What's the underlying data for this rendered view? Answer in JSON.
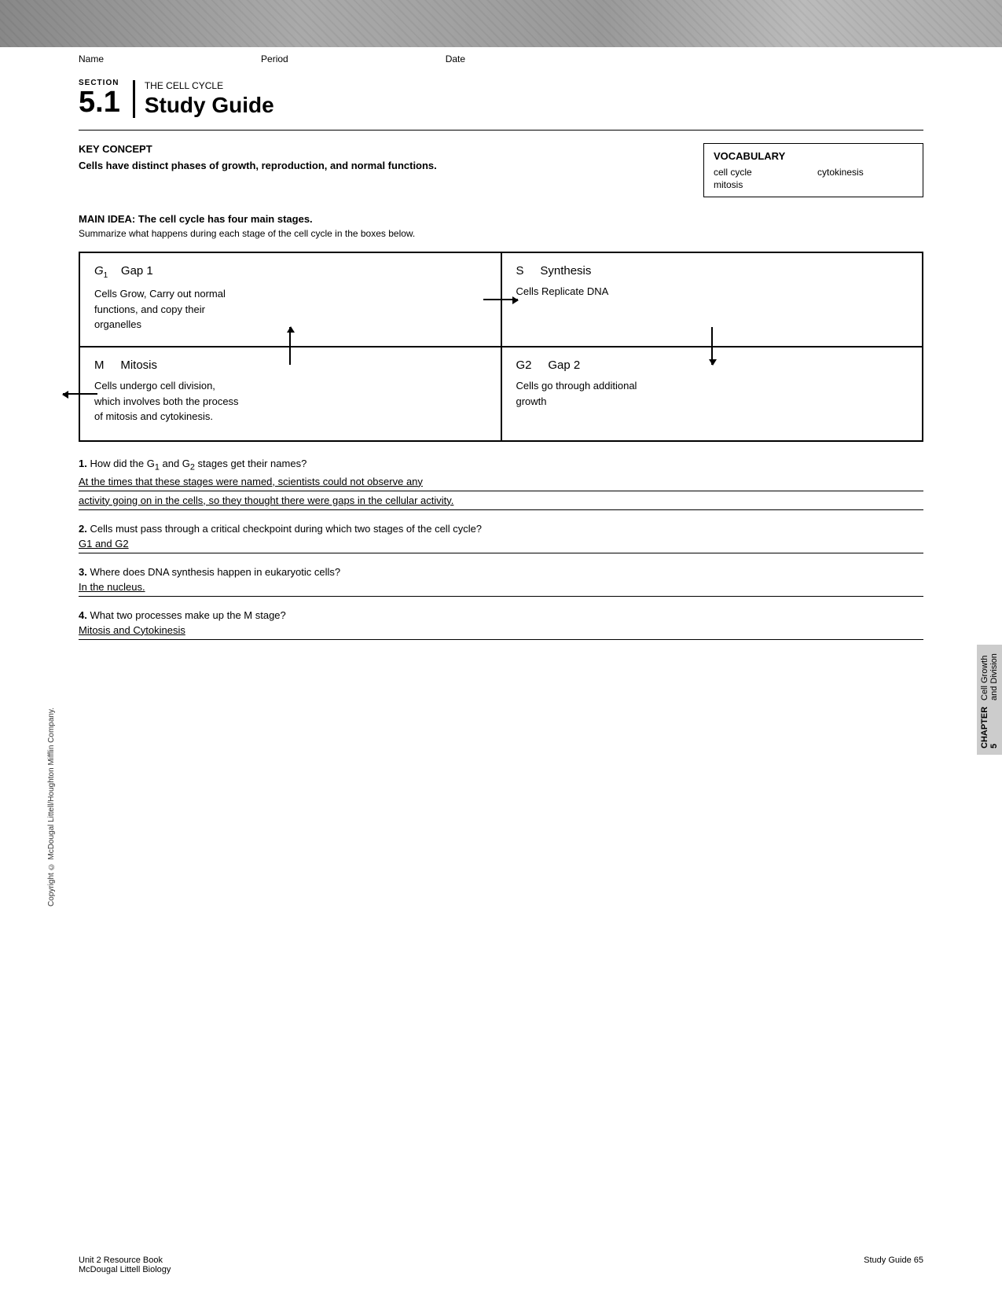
{
  "header": {
    "alt": "Cell biology header image"
  },
  "fields": {
    "name_label": "Name",
    "period_label": "Period",
    "date_label": "Date"
  },
  "section": {
    "label": "SECTION",
    "number": "5.1",
    "subtitle": "THE CELL CYCLE",
    "title": "Study Guide"
  },
  "key_concept": {
    "title": "KEY CONCEPT",
    "text": "Cells have distinct phases of growth, reproduction, and normal functions."
  },
  "vocabulary": {
    "title": "VOCABULARY",
    "terms": [
      "cell cycle",
      "cytokinesis",
      "mitosis",
      ""
    ]
  },
  "main_idea": {
    "label": "MAIN IDEA:",
    "title": "The cell cycle has four main stages.",
    "subtitle": "Summarize what happens during each stage of the cell cycle in the boxes below."
  },
  "diagram": {
    "cells": [
      {
        "id": "g1",
        "letter": "G",
        "subscript": "1",
        "name": "Gap 1",
        "text": "Cells Grow, Carry out normal functions, and copy their organelles"
      },
      {
        "id": "s",
        "letter": "S",
        "subscript": "",
        "name": "Synthesis",
        "text": "Cells Replicate DNA"
      },
      {
        "id": "m",
        "letter": "M",
        "subscript": "",
        "name": "Mitosis",
        "text": "Cells undergo cell division, which involves both the process of mitosis and cytokinesis."
      },
      {
        "id": "g2",
        "letter": "G2",
        "subscript": "",
        "name": "Gap 2",
        "text": "Cells go through additional growth"
      }
    ]
  },
  "questions": [
    {
      "number": "1.",
      "text": "How did the G",
      "text_sub": "1",
      "text_rest": " and G",
      "text_sub2": "2",
      "text_end": " stages get their names?",
      "answer1": "At the times that these stages were named, scientists could not observe any",
      "answer2": "activity going on in the cells, so they thought there were gaps in the cellular activity."
    },
    {
      "number": "2.",
      "text": "Cells must pass through a critical checkpoint during which two stages of the cell cycle?",
      "answer": "G1 and G2"
    },
    {
      "number": "3.",
      "text": "Where does DNA synthesis happen in eukaryotic cells?",
      "answer": "In the nucleus."
    },
    {
      "number": "4.",
      "text": "What two processes make up the M stage?",
      "answer": "Mitosis and Cytokinesis"
    }
  ],
  "footer": {
    "left_line1": "Unit 2 Resource Book",
    "left_line2": "McDougal Littell Biology",
    "right": "Study Guide   65"
  },
  "side_label": {
    "chapter": "CHAPTER 5",
    "text": "Cell Growth and Division"
  },
  "copyright": "Copyright © McDougal Littell/Houghton Mifflin Company."
}
